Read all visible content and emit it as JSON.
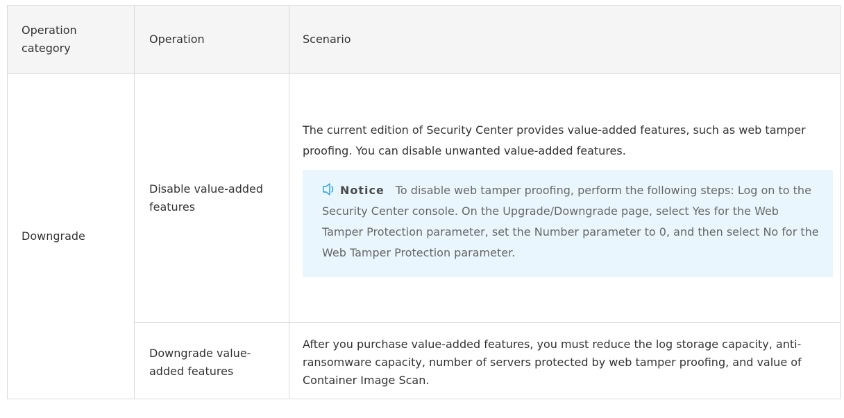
{
  "table": {
    "headers": [
      "Operation category",
      "Operation",
      "Scenario"
    ],
    "category": "Downgrade",
    "rows": [
      {
        "operation": "Disable value-added features",
        "scenario": "The current edition of Security Center provides value-added features, such as web tamper proofing. You can disable unwanted value-added features.",
        "notice": {
          "icon": "speaker-icon",
          "label": "Notice",
          "text": "To disable web tamper proofing, perform the following steps: Log on to the Security Center console. On the Upgrade/Downgrade page, select Yes for the Web Tamper Protection parameter, set the Number parameter to 0, and then select No for the Web Tamper Protection parameter."
        }
      },
      {
        "operation": "Downgrade value-added features",
        "scenario": "After you purchase value-added features, you must reduce the log storage capacity, anti-ransomware capacity, number of servers protected by web tamper proofing, and value of Container Image Scan."
      }
    ]
  },
  "colors": {
    "header_bg": "#f5f5f5",
    "border": "#d9d9d9",
    "notice_bg": "#eaf6fd",
    "notice_icon": "#1a9fe0"
  }
}
